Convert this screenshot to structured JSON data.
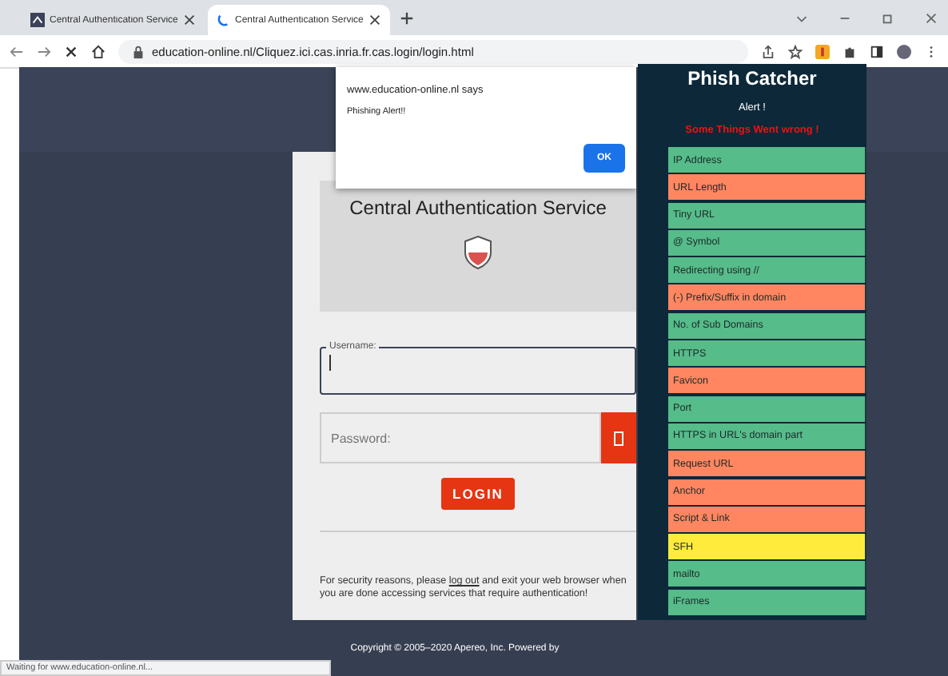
{
  "browser": {
    "tabs": [
      {
        "title": "Central Authentication Service",
        "selected": false
      },
      {
        "title": "Central Authentication Service",
        "selected": true
      }
    ],
    "address": "education-online.nl/Cliquez.ici.cas.inria.fr.cas.login/login.html",
    "status": "Waiting for www.education-online.nl..."
  },
  "login": {
    "title": "Central Authentication Service",
    "username": {
      "label": "Username:"
    },
    "password": {
      "placeholder": "Password:"
    },
    "button": "LOGIN",
    "notice": {
      "before": "For security reasons, please ",
      "link": "log out",
      "after": " and exit your web browser when you are done accessing services that require authentication!"
    }
  },
  "footer": "Copyright © 2005–2020 Apereo, Inc. Powered by",
  "dialog": {
    "title": "www.education-online.nl says",
    "message": "Phishing Alert!!",
    "button": "OK"
  },
  "extension": {
    "title": "Phish Catcher",
    "alert": "Alert !",
    "warning": "Some Things Went wrong !",
    "checks": [
      {
        "label": "IP Address",
        "color": "#56bc8a"
      },
      {
        "label": "URL Length",
        "color": "#ff8660"
      },
      {
        "label": "Tiny URL",
        "color": "#56bc8a"
      },
      {
        "label": "@ Symbol",
        "color": "#56bc8a"
      },
      {
        "label": "Redirecting using //",
        "color": "#56bc8a"
      },
      {
        "label": "(-) Prefix/Suffix in domain",
        "color": "#ff8660"
      },
      {
        "label": "No. of Sub Domains",
        "color": "#56bc8a"
      },
      {
        "label": "HTTPS",
        "color": "#56bc8a"
      },
      {
        "label": "Favicon",
        "color": "#ff8660"
      },
      {
        "label": "Port",
        "color": "#56bc8a"
      },
      {
        "label": "HTTPS in URL's domain part",
        "color": "#56bc8a"
      },
      {
        "label": "Request URL",
        "color": "#ff8660"
      },
      {
        "label": "Anchor",
        "color": "#ff8660"
      },
      {
        "label": "Script & Link",
        "color": "#ff8660"
      },
      {
        "label": "SFH",
        "color": "#ffeb3b"
      },
      {
        "label": "mailto",
        "color": "#56bc8a"
      },
      {
        "label": "iFrames",
        "color": "#56bc8a"
      }
    ]
  }
}
